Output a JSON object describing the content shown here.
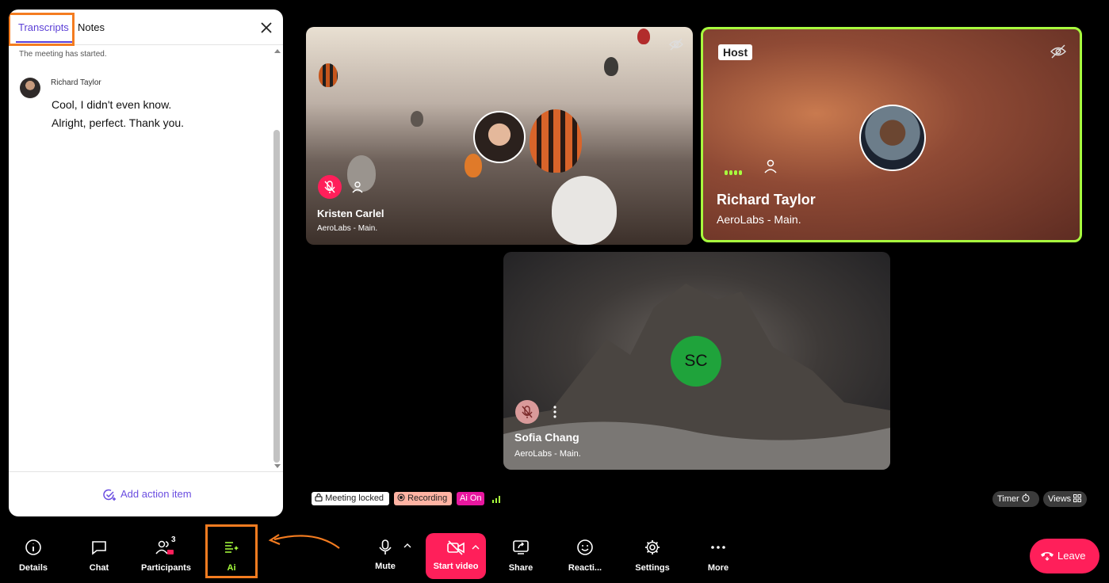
{
  "panel": {
    "tabs": {
      "transcripts": "Transcripts",
      "notes": "Notes"
    },
    "system_message": "The meeting has started.",
    "entry": {
      "speaker": "Richard Taylor",
      "lines": [
        "Cool, I didn't even know.",
        "Alright, perfect. Thank you."
      ]
    },
    "action_label": "Add action item"
  },
  "participants": [
    {
      "name": "Kristen Carlel",
      "org": "AeroLabs - Main.",
      "muted": true
    },
    {
      "name": "Richard Taylor",
      "org": "AeroLabs - Main.",
      "role": "Host",
      "speaking": true
    },
    {
      "name": "Sofia Chang",
      "org": "AeroLabs - Main.",
      "initials": "SC",
      "muted": true
    }
  ],
  "status": {
    "locked": "Meeting locked",
    "recording": "Recording",
    "ai": "Ai On"
  },
  "right_controls": {
    "timer": "Timer",
    "views": "Views"
  },
  "toolbar": {
    "details": "Details",
    "chat": "Chat",
    "participants": "Participants",
    "participants_count": "3",
    "ai": "Ai",
    "mute": "Mute",
    "start_video": "Start video",
    "share": "Share",
    "reactions": "Reacti...",
    "settings": "Settings",
    "more": "More",
    "leave": "Leave"
  },
  "colors": {
    "accent": "#5b3fd6",
    "brand_red": "#ff1f5a",
    "speaking_green": "#a8ff3e",
    "highlight": "#f47c20"
  }
}
